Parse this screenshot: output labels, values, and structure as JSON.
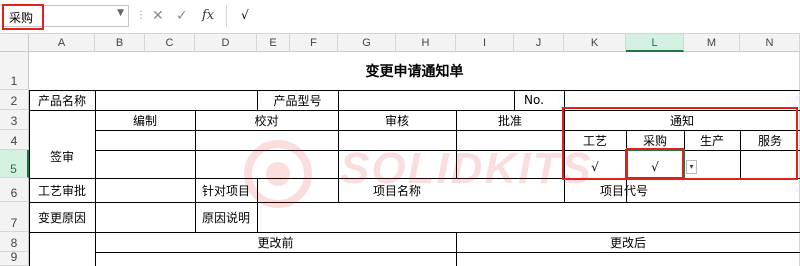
{
  "formula_bar": {
    "name_box_value": "采购",
    "formula_value": "√",
    "fx_label": "fx",
    "cancel_symbol": "✕",
    "enter_symbol": "✓"
  },
  "columns": [
    "A",
    "B",
    "C",
    "D",
    "E",
    "F",
    "G",
    "H",
    "I",
    "J",
    "K",
    "L",
    "M",
    "N"
  ],
  "rows": [
    "1",
    "2",
    "3",
    "4",
    "5",
    "6",
    "7",
    "8",
    "9"
  ],
  "form": {
    "title": "变更申请通知单",
    "product_name_label": "产品名称",
    "product_model_label": "产品型号",
    "no_label": "No.",
    "sign_label": "签审",
    "compile_label": "编制",
    "proofread_label": "校对",
    "review_label": "审核",
    "approve_label": "批准",
    "notify_label": "通知",
    "craft_label": "工艺",
    "purchase_label": "采购",
    "production_label": "生产",
    "service_label": "服务",
    "craft_check": "√",
    "purchase_check": "√",
    "process_approval_label": "工艺审批",
    "target_item_label": "针对项目",
    "item_name_label": "项目名称",
    "item_code_label": "项目代号",
    "change_reason_label": "变更原因",
    "reason_desc_label": "原因说明",
    "before_change_label": "更改前",
    "after_change_label": "更改后"
  },
  "watermark": {
    "text": "SOLIDKITS"
  },
  "colors": {
    "highlight_red": "#e2201c",
    "excel_green": "#217346"
  }
}
